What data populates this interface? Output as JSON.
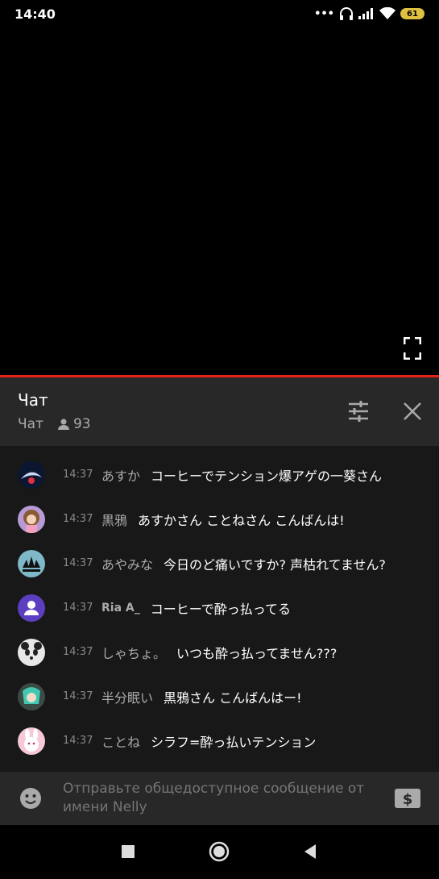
{
  "status": {
    "time": "14:40",
    "battery": "61"
  },
  "chat": {
    "title": "Чат",
    "mode": "Чат",
    "viewers": "93"
  },
  "messages": [
    {
      "time": "14:37",
      "author": "あすか",
      "text": "コーヒーでテンション爆アゲの一葵さん",
      "avatar": "dark-blue-abstract"
    },
    {
      "time": "14:37",
      "author": "黒鴉",
      "text": "あすかさん ことねさん こんばんは!",
      "avatar": "anime-girl-pink"
    },
    {
      "time": "14:37",
      "author": "あやみな",
      "text": "今日のど痛いですか? 声枯れてません?",
      "avatar": "adidas-logo"
    },
    {
      "time": "14:37",
      "author": "Ria A_",
      "text": "コーヒーで酔っ払ってる",
      "avatar": "default-user-purple"
    },
    {
      "time": "14:37",
      "author": "しゃちょ。",
      "text": "いつも酔っ払ってません???",
      "avatar": "panda"
    },
    {
      "time": "14:37",
      "author": "半分眠い",
      "text": "黒鴉さん こんばんはー!",
      "avatar": "anime-green-hair"
    },
    {
      "time": "14:37",
      "author": "ことね",
      "text": "シラフ=酔っ払いテンション",
      "avatar": "pink-bunny"
    }
  ],
  "composer": {
    "placeholder": "Отправьте общедоступное сообщение от имени Nelly"
  },
  "colors": {
    "progress": "#e62117",
    "header_bg": "#282828",
    "chat_bg": "#181818"
  }
}
